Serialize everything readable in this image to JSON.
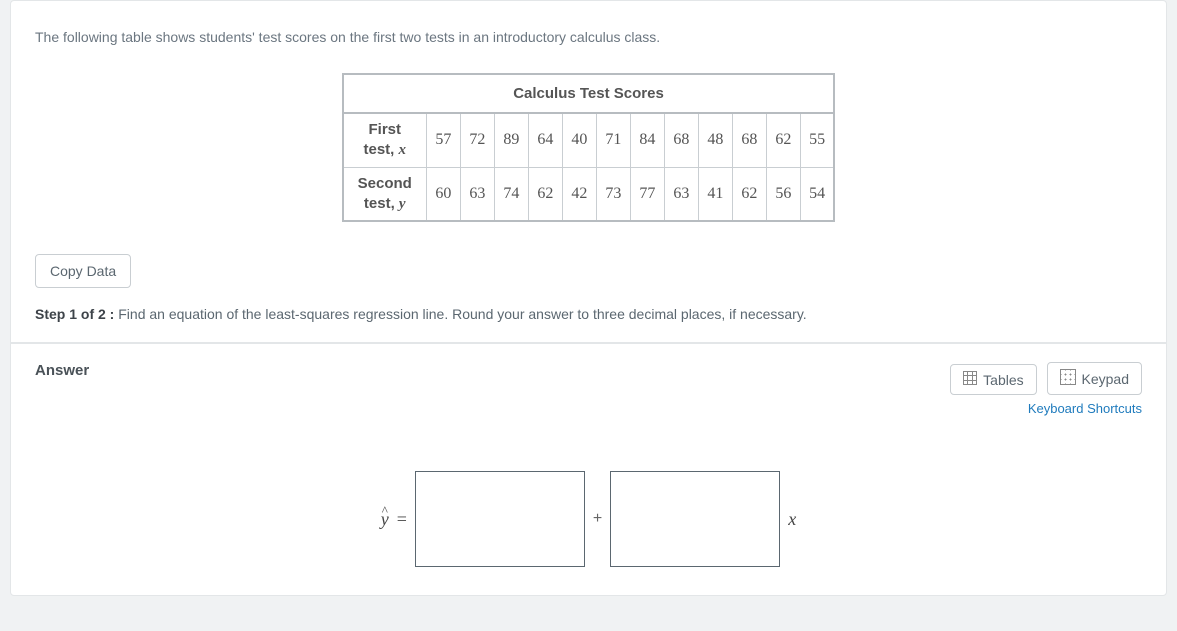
{
  "question": {
    "prompt": "The following table shows students' test scores on the first two tests in an introductory calculus class.",
    "table_title": "Calculus Test Scores",
    "row1_label_line1": "First",
    "row1_label_line2": "test,",
    "row1_var": "x",
    "row1": [
      "57",
      "72",
      "89",
      "64",
      "40",
      "71",
      "84",
      "68",
      "48",
      "68",
      "62",
      "55"
    ],
    "row2_label_line1": "Second",
    "row2_label_line2": "test,",
    "row2_var": "y",
    "row2": [
      "60",
      "63",
      "74",
      "62",
      "42",
      "73",
      "77",
      "63",
      "41",
      "62",
      "56",
      "54"
    ],
    "copy_label": "Copy Data",
    "step_bold": "Step 1 of 2 :",
    "step_text": "  Find an equation of the least-squares regression line. Round your answer to three decimal places, if necessary."
  },
  "answer": {
    "label": "Answer",
    "tables_btn": "Tables",
    "keypad_btn": "Keypad",
    "shortcut_link": "Keyboard Shortcuts",
    "yhat": "ŷ",
    "equals": "=",
    "plus": "+",
    "xvar": "x",
    "input1": "",
    "input2": ""
  }
}
